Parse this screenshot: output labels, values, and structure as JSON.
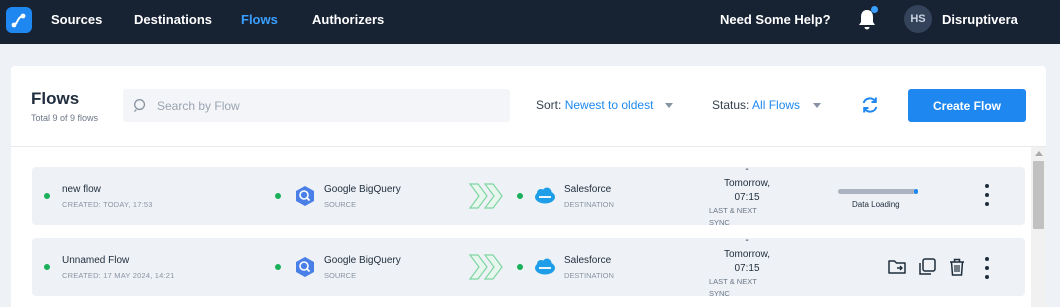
{
  "nav": {
    "items": [
      {
        "label": "Sources",
        "active": false
      },
      {
        "label": "Destinations",
        "active": false
      },
      {
        "label": "Flows",
        "active": true
      },
      {
        "label": "Authorizers",
        "active": false
      }
    ],
    "help_label": "Need Some Help?",
    "user_initials": "HS",
    "user_name": "Disruptivera",
    "has_notification": true
  },
  "header": {
    "title": "Flows",
    "subtitle": "Total 9 of 9 flows",
    "search_placeholder": "Search by Flow",
    "sort_label": "Sort:",
    "sort_value": "Newest to oldest",
    "status_label": "Status:",
    "status_value": "All Flows",
    "create_label": "Create Flow"
  },
  "flows": [
    {
      "name": "new flow",
      "created": "CREATED: Today, 17:53",
      "source_name": "Google BigQuery",
      "source_role": "SOURCE",
      "destination_name": "Salesforce",
      "destination_role": "DESTINATION",
      "sync_dash": "-",
      "sync_line1": "Tomorrow,",
      "sync_line2": "07:15",
      "sync_label1": "LAST & NEXT",
      "sync_label2": "SYNC",
      "status_text": "Data Loading",
      "progress": 0.95
    },
    {
      "name": "Unnamed Flow",
      "created": "CREATED: 17 May 2024, 14:21",
      "source_name": "Google BigQuery",
      "source_role": "SOURCE",
      "destination_name": "Salesforce",
      "destination_role": "DESTINATION",
      "sync_dash": "-",
      "sync_line1": "Tomorrow,",
      "sync_line2": "07:15",
      "sync_label1": "LAST & NEXT",
      "sync_label2": "SYNC"
    }
  ],
  "colors": {
    "nav_bg": "#172233",
    "accent": "#1e88f0",
    "active_dot": "#1bb05a",
    "arrow": "#7fd6a4"
  },
  "icons": [
    "app-logo-icon",
    "bell-icon",
    "search-icon",
    "refresh-icon",
    "bigquery-icon",
    "salesforce-icon",
    "flow-arrows-icon",
    "kebab-icon",
    "folder-move-icon",
    "duplicate-icon",
    "trash-icon"
  ]
}
